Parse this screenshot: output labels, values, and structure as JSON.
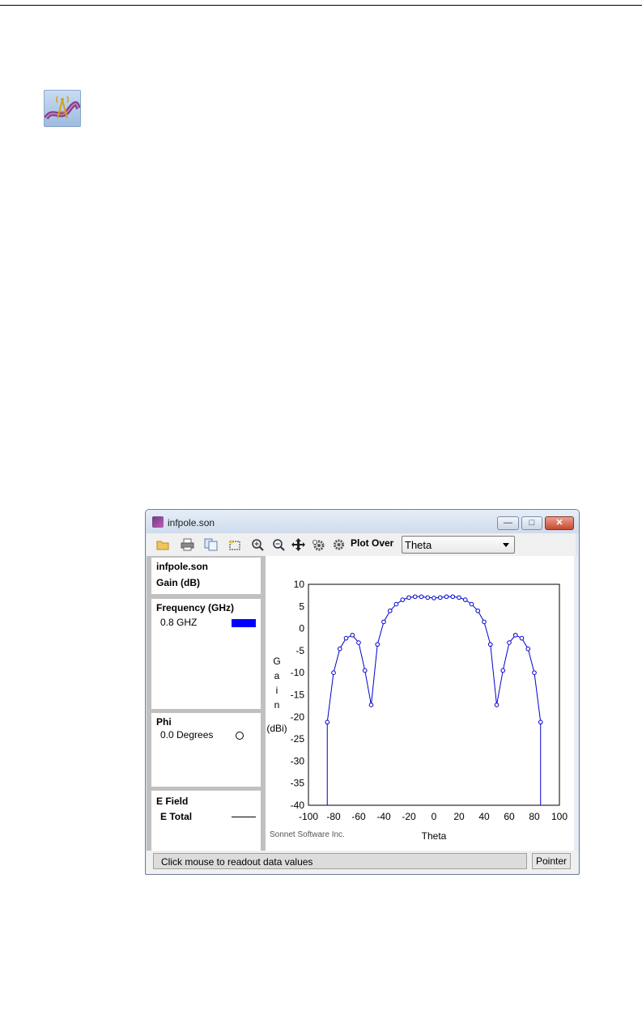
{
  "window": {
    "title": "infpole.son",
    "toolbar": {
      "plot_over_label": "Plot Over",
      "plot_over_value": "Theta"
    },
    "legend": {
      "file_name": "infpole.son",
      "quantity": "Gain (dB)",
      "frequency": {
        "header": "Frequency (GHz)",
        "item": "0.8 GHZ",
        "swatch_color": "#0000ff"
      },
      "phi": {
        "header": "Phi",
        "item": "0.0 Degrees"
      },
      "efield": {
        "header": "E Field",
        "item": "E Total"
      }
    },
    "watermark": "Sonnet Software Inc.",
    "status": {
      "message": "Click mouse to readout data values",
      "mode_button": "Pointer"
    }
  },
  "chart_data": {
    "type": "line",
    "xlabel": "Theta",
    "ylabel_letters": [
      "G",
      "a",
      "i",
      "n"
    ],
    "ylabel_units": "(dBi)",
    "xlim": [
      -100,
      100
    ],
    "ylim": [
      -40,
      10
    ],
    "x_ticks": [
      -100,
      -80,
      -60,
      -40,
      -20,
      0,
      20,
      40,
      60,
      80,
      100
    ],
    "y_ticks": [
      10,
      5,
      0,
      -5,
      -10,
      -15,
      -20,
      -25,
      -30,
      -35,
      -40
    ],
    "series": [
      {
        "name": "0.8 GHZ",
        "color": "#0000cc",
        "x": [
          -85,
          -80,
          -75,
          -70,
          -65,
          -60,
          -55,
          -50,
          -45,
          -40,
          -35,
          -30,
          -25,
          -20,
          -15,
          -10,
          -5,
          0,
          5,
          10,
          15,
          20,
          25,
          30,
          35,
          40,
          45,
          50,
          55,
          60,
          65,
          70,
          75,
          80,
          85
        ],
        "y": [
          -21.2,
          -10,
          -4.6,
          -2.2,
          -1.5,
          -3.2,
          -9.5,
          -17.3,
          -3.6,
          1.5,
          4,
          5.5,
          6.5,
          7,
          7.2,
          7.2,
          7,
          6.9,
          7,
          7.2,
          7.2,
          7,
          6.5,
          5.5,
          4,
          1.5,
          -3.6,
          -17.3,
          -9.5,
          -3.2,
          -1.5,
          -2.2,
          -4.6,
          -10,
          -21.2
        ]
      }
    ]
  }
}
